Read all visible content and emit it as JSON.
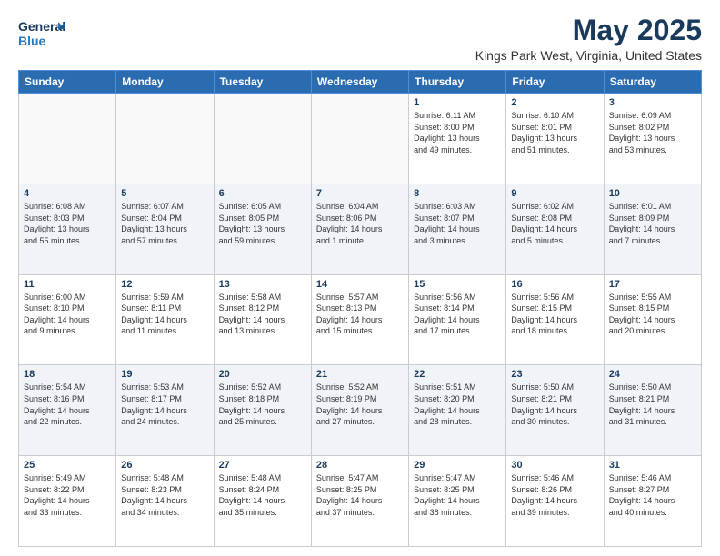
{
  "logo": {
    "line1": "General",
    "line2": "Blue"
  },
  "title": "May 2025",
  "subtitle": "Kings Park West, Virginia, United States",
  "days_header": [
    "Sunday",
    "Monday",
    "Tuesday",
    "Wednesday",
    "Thursday",
    "Friday",
    "Saturday"
  ],
  "weeks": [
    [
      {
        "num": "",
        "info": ""
      },
      {
        "num": "",
        "info": ""
      },
      {
        "num": "",
        "info": ""
      },
      {
        "num": "",
        "info": ""
      },
      {
        "num": "1",
        "info": "Sunrise: 6:11 AM\nSunset: 8:00 PM\nDaylight: 13 hours\nand 49 minutes."
      },
      {
        "num": "2",
        "info": "Sunrise: 6:10 AM\nSunset: 8:01 PM\nDaylight: 13 hours\nand 51 minutes."
      },
      {
        "num": "3",
        "info": "Sunrise: 6:09 AM\nSunset: 8:02 PM\nDaylight: 13 hours\nand 53 minutes."
      }
    ],
    [
      {
        "num": "4",
        "info": "Sunrise: 6:08 AM\nSunset: 8:03 PM\nDaylight: 13 hours\nand 55 minutes."
      },
      {
        "num": "5",
        "info": "Sunrise: 6:07 AM\nSunset: 8:04 PM\nDaylight: 13 hours\nand 57 minutes."
      },
      {
        "num": "6",
        "info": "Sunrise: 6:05 AM\nSunset: 8:05 PM\nDaylight: 13 hours\nand 59 minutes."
      },
      {
        "num": "7",
        "info": "Sunrise: 6:04 AM\nSunset: 8:06 PM\nDaylight: 14 hours\nand 1 minute."
      },
      {
        "num": "8",
        "info": "Sunrise: 6:03 AM\nSunset: 8:07 PM\nDaylight: 14 hours\nand 3 minutes."
      },
      {
        "num": "9",
        "info": "Sunrise: 6:02 AM\nSunset: 8:08 PM\nDaylight: 14 hours\nand 5 minutes."
      },
      {
        "num": "10",
        "info": "Sunrise: 6:01 AM\nSunset: 8:09 PM\nDaylight: 14 hours\nand 7 minutes."
      }
    ],
    [
      {
        "num": "11",
        "info": "Sunrise: 6:00 AM\nSunset: 8:10 PM\nDaylight: 14 hours\nand 9 minutes."
      },
      {
        "num": "12",
        "info": "Sunrise: 5:59 AM\nSunset: 8:11 PM\nDaylight: 14 hours\nand 11 minutes."
      },
      {
        "num": "13",
        "info": "Sunrise: 5:58 AM\nSunset: 8:12 PM\nDaylight: 14 hours\nand 13 minutes."
      },
      {
        "num": "14",
        "info": "Sunrise: 5:57 AM\nSunset: 8:13 PM\nDaylight: 14 hours\nand 15 minutes."
      },
      {
        "num": "15",
        "info": "Sunrise: 5:56 AM\nSunset: 8:14 PM\nDaylight: 14 hours\nand 17 minutes."
      },
      {
        "num": "16",
        "info": "Sunrise: 5:56 AM\nSunset: 8:15 PM\nDaylight: 14 hours\nand 18 minutes."
      },
      {
        "num": "17",
        "info": "Sunrise: 5:55 AM\nSunset: 8:15 PM\nDaylight: 14 hours\nand 20 minutes."
      }
    ],
    [
      {
        "num": "18",
        "info": "Sunrise: 5:54 AM\nSunset: 8:16 PM\nDaylight: 14 hours\nand 22 minutes."
      },
      {
        "num": "19",
        "info": "Sunrise: 5:53 AM\nSunset: 8:17 PM\nDaylight: 14 hours\nand 24 minutes."
      },
      {
        "num": "20",
        "info": "Sunrise: 5:52 AM\nSunset: 8:18 PM\nDaylight: 14 hours\nand 25 minutes."
      },
      {
        "num": "21",
        "info": "Sunrise: 5:52 AM\nSunset: 8:19 PM\nDaylight: 14 hours\nand 27 minutes."
      },
      {
        "num": "22",
        "info": "Sunrise: 5:51 AM\nSunset: 8:20 PM\nDaylight: 14 hours\nand 28 minutes."
      },
      {
        "num": "23",
        "info": "Sunrise: 5:50 AM\nSunset: 8:21 PM\nDaylight: 14 hours\nand 30 minutes."
      },
      {
        "num": "24",
        "info": "Sunrise: 5:50 AM\nSunset: 8:21 PM\nDaylight: 14 hours\nand 31 minutes."
      }
    ],
    [
      {
        "num": "25",
        "info": "Sunrise: 5:49 AM\nSunset: 8:22 PM\nDaylight: 14 hours\nand 33 minutes."
      },
      {
        "num": "26",
        "info": "Sunrise: 5:48 AM\nSunset: 8:23 PM\nDaylight: 14 hours\nand 34 minutes."
      },
      {
        "num": "27",
        "info": "Sunrise: 5:48 AM\nSunset: 8:24 PM\nDaylight: 14 hours\nand 35 minutes."
      },
      {
        "num": "28",
        "info": "Sunrise: 5:47 AM\nSunset: 8:25 PM\nDaylight: 14 hours\nand 37 minutes."
      },
      {
        "num": "29",
        "info": "Sunrise: 5:47 AM\nSunset: 8:25 PM\nDaylight: 14 hours\nand 38 minutes."
      },
      {
        "num": "30",
        "info": "Sunrise: 5:46 AM\nSunset: 8:26 PM\nDaylight: 14 hours\nand 39 minutes."
      },
      {
        "num": "31",
        "info": "Sunrise: 5:46 AM\nSunset: 8:27 PM\nDaylight: 14 hours\nand 40 minutes."
      }
    ]
  ]
}
